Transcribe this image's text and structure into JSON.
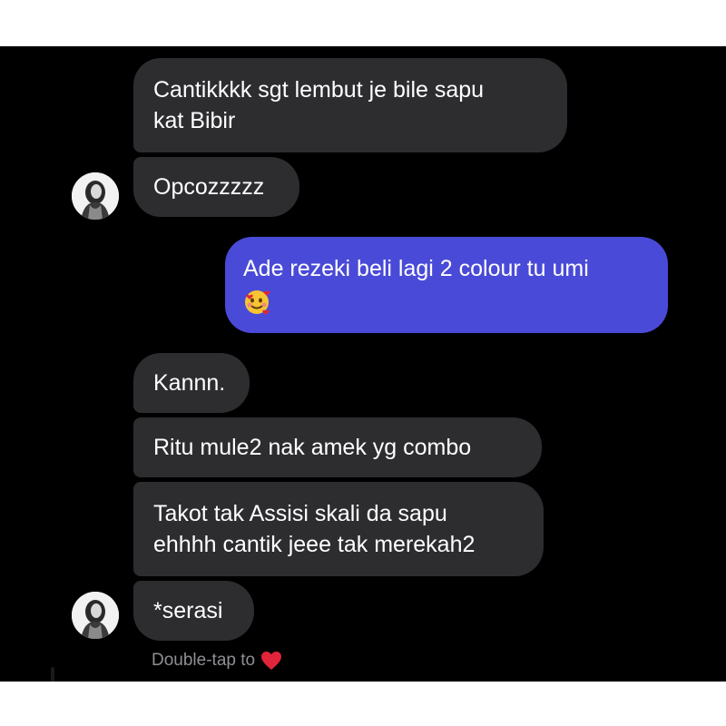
{
  "messages": [
    {
      "text_lines": [
        "Cantikkkk sgt lembut je bile sapu",
        "kat Bibir"
      ],
      "side": "incoming"
    },
    {
      "text": "Opcozzzzz",
      "side": "incoming"
    },
    {
      "text_lines": [
        "Ade rezeki beli lagi 2 colour tu umi"
      ],
      "emoji": "smiling-face-with-hearts",
      "side": "outgoing"
    },
    {
      "text": "Kannn.",
      "side": "incoming"
    },
    {
      "text": "Ritu mule2 nak amek yg combo",
      "side": "incoming"
    },
    {
      "text_lines": [
        "Takot tak Assisi skali da sapu",
        "ehhhh cantik jeee tak merekah2"
      ],
      "side": "incoming"
    },
    {
      "text": "*serasi",
      "side": "incoming"
    }
  ],
  "hint": {
    "text": "Double-tap to",
    "icon": "heart-icon"
  },
  "colors": {
    "background": "#000000",
    "incoming_bubble": "#2d2d30",
    "outgoing_bubble": "#4a4ad8",
    "hint_text": "#8f8f94",
    "heart": "#e0243a"
  }
}
